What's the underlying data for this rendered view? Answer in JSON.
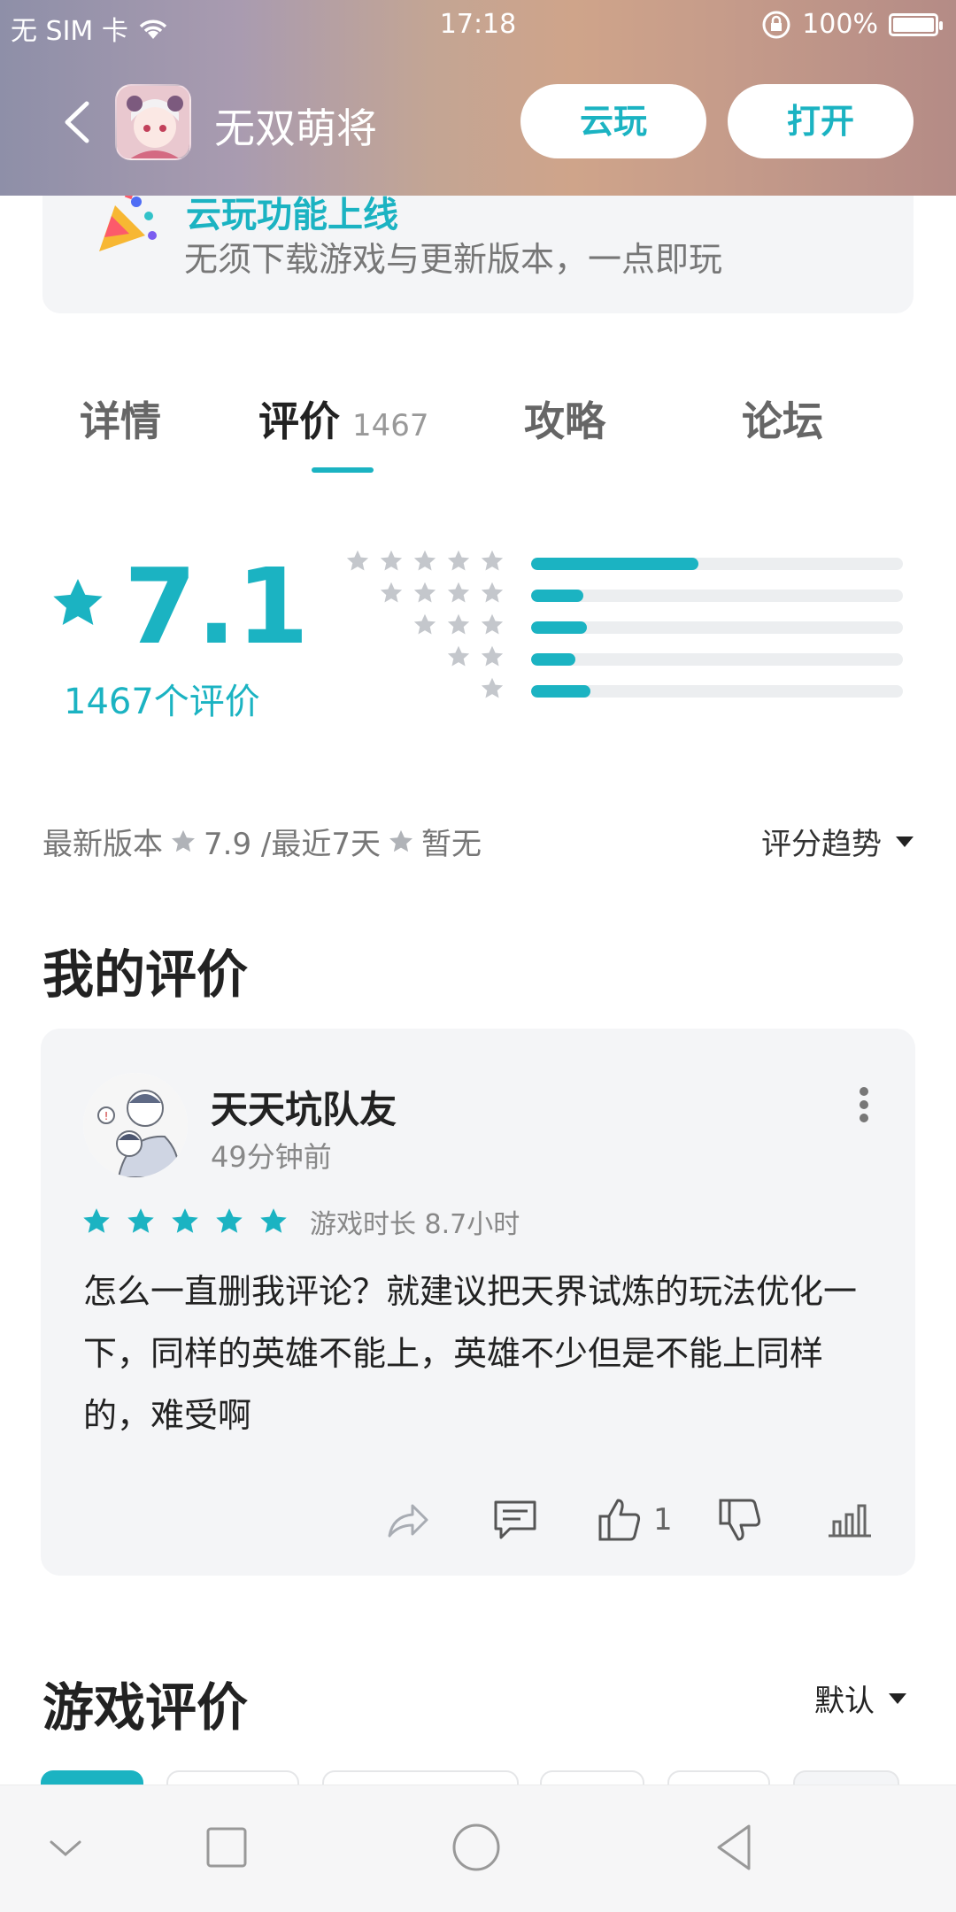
{
  "status_bar": {
    "carrier": "无 SIM 卡",
    "time": "17:18",
    "battery": "100%"
  },
  "header": {
    "app_name": "无双萌将",
    "cloud_play_label": "云玩",
    "open_label": "打开"
  },
  "banner": {
    "title": "云玩功能上线",
    "subtitle": "无须下载游戏与更新版本，一点即玩"
  },
  "tabs": {
    "details": "详情",
    "reviews": "评价",
    "reviews_count": "1467",
    "guide": "攻略",
    "forum": "论坛",
    "active": "reviews"
  },
  "rating": {
    "score": "7.1",
    "count_label": "1467个评价",
    "distribution": [
      {
        "stars": 5,
        "fraction": 0.45
      },
      {
        "stars": 4,
        "fraction": 0.14
      },
      {
        "stars": 3,
        "fraction": 0.15
      },
      {
        "stars": 2,
        "fraction": 0.12
      },
      {
        "stars": 1,
        "fraction": 0.16
      }
    ]
  },
  "meta": {
    "latest_version_label": "最新版本",
    "latest_score": "7.9 /最近7天",
    "recent_score": "暂无",
    "trend_label": "评分趋势"
  },
  "my_review": {
    "section_title": "我的评价",
    "user_name": "天天坑队友",
    "time": "49分钟前",
    "stars": 5,
    "play_time": "游戏时长 8.7小时",
    "text": "怎么一直删我评论？就建议把天界试炼的玩法优化一下，同样的英雄不能上，英雄不少但是不能上同样的，难受啊",
    "likes": "1"
  },
  "game_reviews": {
    "section_title": "游戏评价",
    "sort_label": "默认"
  },
  "colors": {
    "accent": "#1bb3c2",
    "card_bg": "#f4f5f7"
  }
}
